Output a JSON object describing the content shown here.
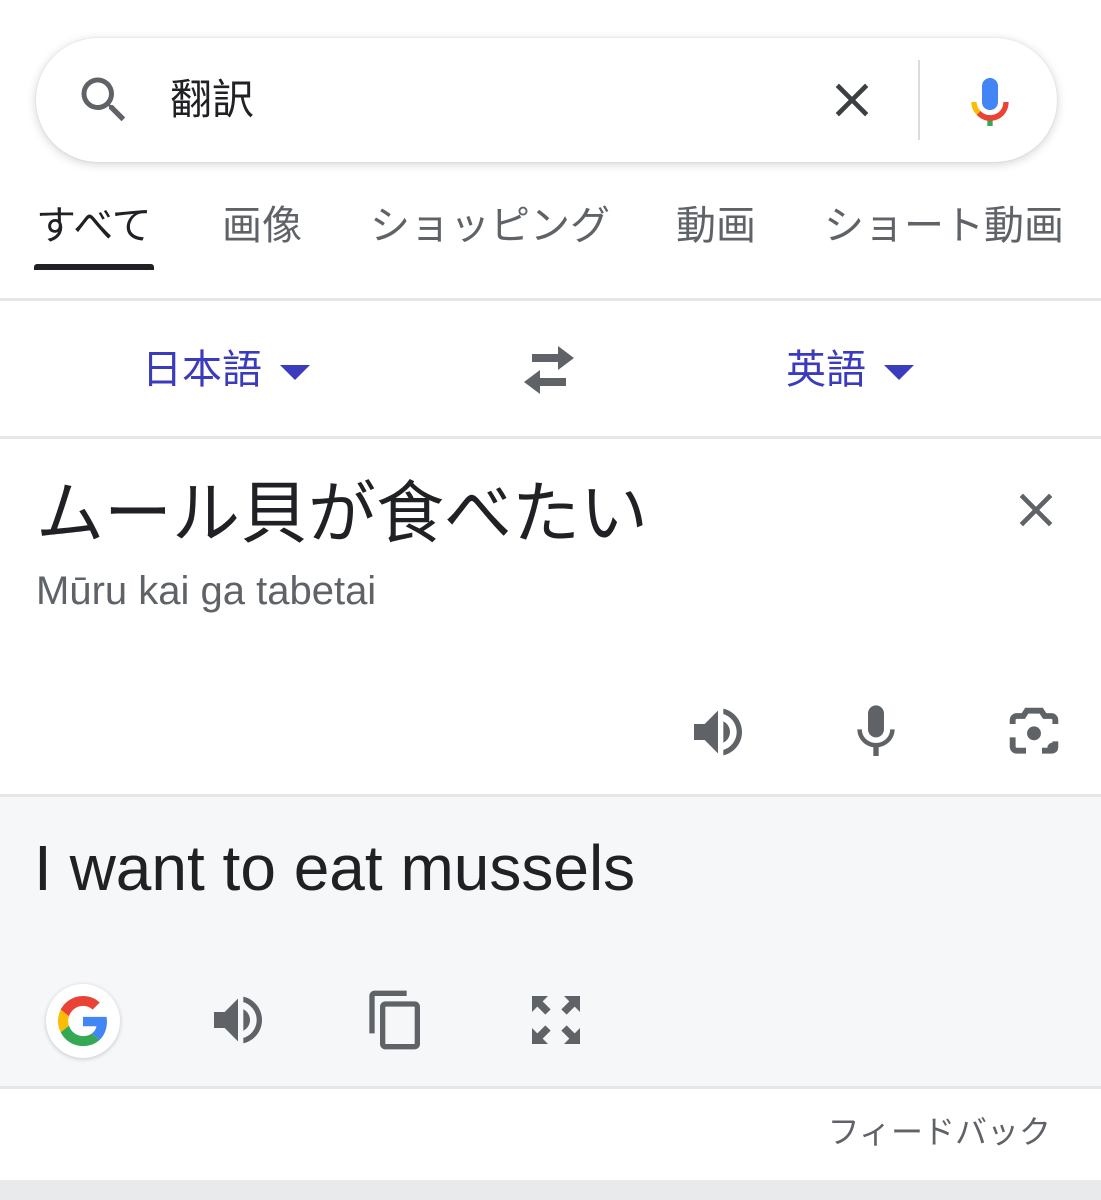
{
  "search": {
    "query": "翻訳",
    "icons": {
      "search": "search-icon",
      "clear": "close-icon",
      "voice": "mic-icon"
    }
  },
  "tabs": [
    {
      "label": "すべて",
      "active": true
    },
    {
      "label": "画像",
      "active": false
    },
    {
      "label": "ショッピング",
      "active": false
    },
    {
      "label": "動画",
      "active": false
    },
    {
      "label": "ショート動画",
      "active": false
    }
  ],
  "translator": {
    "source_language": "日本語",
    "target_language": "英語",
    "source_text": "ムール貝が食べたい",
    "source_romanization": "Mūru kai ga tabetai",
    "translated_text": "I want to eat mussels",
    "source_actions": [
      "speaker-icon",
      "mic-icon",
      "camera-icon"
    ],
    "target_actions": [
      "google-logo-icon",
      "speaker-icon",
      "copy-icon",
      "fullscreen-icon"
    ],
    "feedback_label": "フィードバック"
  },
  "colors": {
    "language_link": "#3b3bbd",
    "tab_active": "#202124",
    "tab_inactive": "#5f6368",
    "icon_gray": "#5f6368",
    "target_panel_bg": "#f6f7f9",
    "google_blue": "#4285F4",
    "google_red": "#EA4335",
    "google_yellow": "#FBBC05",
    "google_green": "#34A853"
  }
}
